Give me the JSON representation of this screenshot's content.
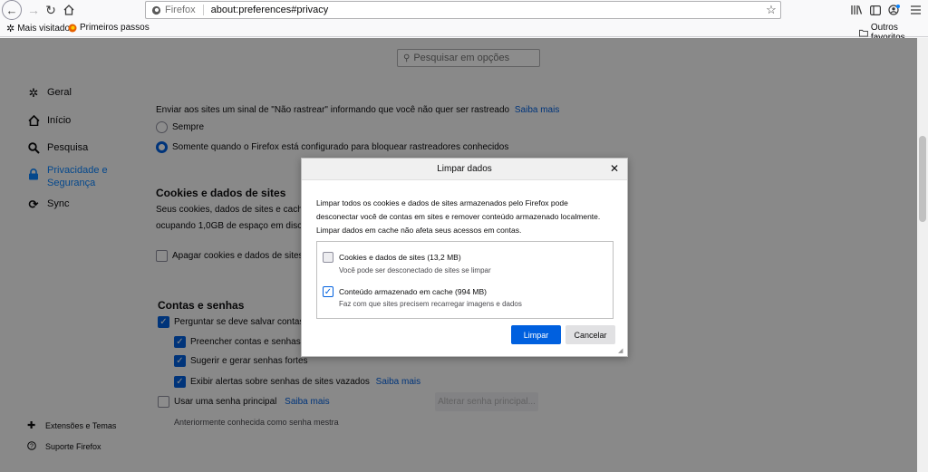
{
  "toolbar": {
    "identity_label": "Firefox",
    "url": "about:preferences#privacy"
  },
  "bookmarks": {
    "items": [
      {
        "label": "Mais visitados"
      },
      {
        "label": "Primeiros passos"
      }
    ],
    "other": "Outros favoritos"
  },
  "search": {
    "placeholder": "Pesquisar em opções"
  },
  "sidebar": {
    "items": [
      {
        "label": "Geral",
        "icon": "gear-icon"
      },
      {
        "label": "Início",
        "icon": "home-icon"
      },
      {
        "label": "Pesquisa",
        "icon": "search-icon"
      },
      {
        "label_line1": "Privacidade e",
        "label_line2": "Segurança",
        "icon": "lock-icon"
      },
      {
        "label": "Sync",
        "icon": "sync-icon"
      }
    ],
    "footer": [
      {
        "label": "Extensões e Temas",
        "icon": "puzzle-icon"
      },
      {
        "label": "Suporte Firefox",
        "icon": "help-icon"
      }
    ]
  },
  "dnt": {
    "text": "Enviar aos sites um sinal de \"Não rastrear\" informando que você não quer ser rastreado",
    "link": "Saiba mais",
    "option_always": "Sempre",
    "option_when_blocking": "Somente quando o Firefox está configurado para bloquear rastreadores conhecidos"
  },
  "cookies": {
    "heading": "Cookies e dados de sites",
    "desc_line1": "Seus cookies, dados de sites e cache a",
    "desc_line2": "ocupando 1,0GB de espaço em disco.",
    "delete_on_close": "Apagar cookies e dados de sites q"
  },
  "logins": {
    "heading": "Contas e senhas",
    "ask_save": "Perguntar se deve salvar contas e",
    "autofill": "Preencher contas e senhas au",
    "suggest": "Sugerir e gerar senhas fortes",
    "breach_alerts": "Exibir alertas sobre senhas de sites vazados",
    "breach_link": "Saiba mais",
    "primary_password": "Usar uma senha principal",
    "primary_link": "Saiba mais",
    "change_primary": "Alterar senha principal...",
    "formerly": "Anteriormente conhecida como senha mestra"
  },
  "dialog": {
    "title": "Limpar dados",
    "desc_line1": "Limpar todos os cookies e dados de sites armazenados pelo Firefox pode",
    "desc_line2": "desconectar você de contas em sites e remover conteúdo armazenado localmente.",
    "desc_line3": "Limpar dados em cache não afeta seus acessos em contas.",
    "options": [
      {
        "label": "Cookies e dados de sites (13,2 MB)",
        "sub": "Você pode ser desconectado de sites se limpar",
        "checked": false
      },
      {
        "label": "Conteúdo armazenado em cache (994 MB)",
        "sub": "Faz com que sites precisem recarregar imagens e dados",
        "checked": true
      }
    ],
    "primary_button": "Limpar",
    "cancel_button": "Cancelar"
  },
  "colors": {
    "accent": "#0060df",
    "selected_category": "#0a84ff"
  }
}
